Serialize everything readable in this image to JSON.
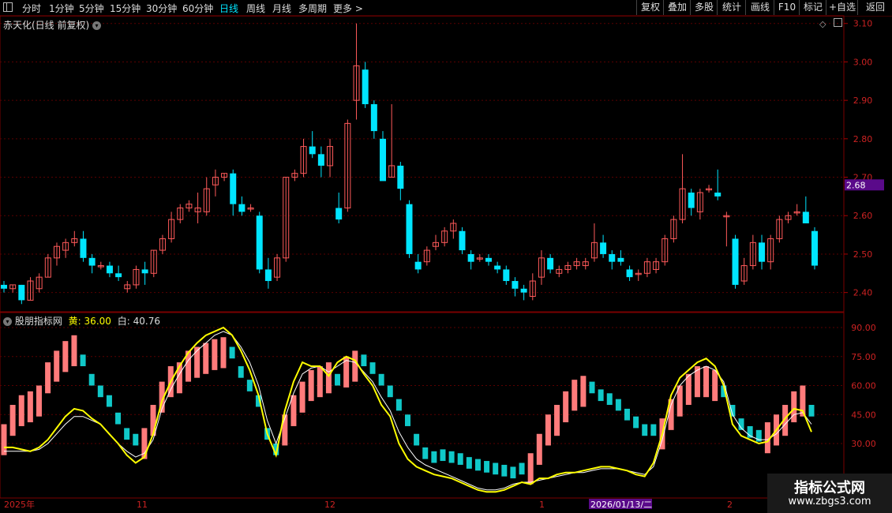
{
  "toolbar": {
    "periods": [
      "分时",
      "1分钟",
      "5分钟",
      "15分钟",
      "30分钟",
      "60分钟",
      "日线",
      "周线",
      "月线",
      "多周期",
      "更多 >"
    ],
    "active_period": "日线",
    "right_buttons": [
      "复权",
      "叠加",
      "多股",
      "统计",
      "画线",
      "F10",
      "标记",
      "+自选",
      "返回"
    ]
  },
  "main_panel": {
    "title": "赤天化(日线 前复权)",
    "price_axis": [
      "3.10",
      "3.00",
      "2.90",
      "2.80",
      "2.70",
      "2.60",
      "2.50",
      "2.40"
    ],
    "current_price": "2.68"
  },
  "indicator_panel": {
    "name": "股朋指标网",
    "yellow_label": "黄:",
    "yellow_value": "36.00",
    "white_label": "白:",
    "white_value": "40.76",
    "axis": [
      "90.00",
      "75.00",
      "60.00",
      "45.00",
      "30.00"
    ]
  },
  "time_axis": [
    "2025年",
    "11",
    "12",
    "1",
    "2026/01/13/二",
    "2"
  ],
  "watermark": {
    "title": "指标公式网",
    "url": "www.zbgs3.com"
  },
  "colors": {
    "up": "#ff5a5a",
    "down": "#00e5ff",
    "yellow": "#ffff00",
    "white": "#ffffff",
    "grid": "#5a0000"
  },
  "chart_data": {
    "type": "candlestick",
    "ohlc": [
      [
        2.42,
        2.43,
        2.4,
        2.41
      ],
      [
        2.41,
        2.42,
        2.4,
        2.42
      ],
      [
        2.42,
        2.42,
        2.37,
        2.38
      ],
      [
        2.38,
        2.44,
        2.38,
        2.43
      ],
      [
        2.41,
        2.45,
        2.4,
        2.44
      ],
      [
        2.44,
        2.5,
        2.44,
        2.49
      ],
      [
        2.49,
        2.53,
        2.47,
        2.52
      ],
      [
        2.51,
        2.54,
        2.49,
        2.53
      ],
      [
        2.53,
        2.56,
        2.52,
        2.54
      ],
      [
        2.54,
        2.56,
        2.48,
        2.49
      ],
      [
        2.49,
        2.5,
        2.45,
        2.47
      ],
      [
        2.47,
        2.48,
        2.46,
        2.47
      ],
      [
        2.47,
        2.48,
        2.44,
        2.45
      ],
      [
        2.45,
        2.47,
        2.43,
        2.44
      ],
      [
        2.41,
        2.43,
        2.4,
        2.42
      ],
      [
        2.42,
        2.47,
        2.41,
        2.46
      ],
      [
        2.46,
        2.48,
        2.42,
        2.45
      ],
      [
        2.45,
        2.51,
        2.44,
        2.51
      ],
      [
        2.51,
        2.55,
        2.5,
        2.54
      ],
      [
        2.54,
        2.61,
        2.53,
        2.59
      ],
      [
        2.59,
        2.63,
        2.58,
        2.62
      ],
      [
        2.62,
        2.64,
        2.61,
        2.63
      ],
      [
        2.61,
        2.66,
        2.58,
        2.62
      ],
      [
        2.61,
        2.7,
        2.6,
        2.67
      ],
      [
        2.68,
        2.72,
        2.65,
        2.7
      ],
      [
        2.7,
        2.71,
        2.69,
        2.71
      ],
      [
        2.71,
        2.72,
        2.6,
        2.63
      ],
      [
        2.63,
        2.65,
        2.6,
        2.61
      ],
      [
        2.62,
        2.63,
        2.61,
        2.62
      ],
      [
        2.6,
        2.61,
        2.45,
        2.46
      ],
      [
        2.46,
        2.49,
        2.41,
        2.43
      ],
      [
        2.44,
        2.5,
        2.43,
        2.49
      ],
      [
        2.49,
        2.7,
        2.48,
        2.7
      ],
      [
        2.7,
        2.72,
        2.69,
        2.71
      ],
      [
        2.71,
        2.8,
        2.7,
        2.78
      ],
      [
        2.78,
        2.82,
        2.75,
        2.76
      ],
      [
        2.76,
        2.78,
        2.7,
        2.73
      ],
      [
        2.73,
        2.8,
        2.7,
        2.78
      ],
      [
        2.62,
        2.66,
        2.58,
        2.59
      ],
      [
        2.62,
        2.85,
        2.61,
        2.84
      ],
      [
        2.9,
        3.1,
        2.85,
        2.99
      ],
      [
        2.98,
        3.0,
        2.88,
        2.89
      ],
      [
        2.89,
        2.9,
        2.8,
        2.82
      ],
      [
        2.8,
        2.82,
        2.7,
        2.69
      ],
      [
        2.7,
        2.89,
        2.7,
        2.73
      ],
      [
        2.73,
        2.74,
        2.64,
        2.67
      ],
      [
        2.63,
        2.64,
        2.49,
        2.5
      ],
      [
        2.48,
        2.5,
        2.45,
        2.46
      ],
      [
        2.48,
        2.52,
        2.47,
        2.51
      ],
      [
        2.52,
        2.55,
        2.51,
        2.53
      ],
      [
        2.53,
        2.57,
        2.52,
        2.56
      ],
      [
        2.56,
        2.59,
        2.54,
        2.58
      ],
      [
        2.56,
        2.57,
        2.5,
        2.51
      ],
      [
        2.5,
        2.51,
        2.46,
        2.48
      ],
      [
        2.49,
        2.5,
        2.48,
        2.49
      ],
      [
        2.49,
        2.5,
        2.47,
        2.48
      ],
      [
        2.47,
        2.48,
        2.45,
        2.46
      ],
      [
        2.46,
        2.47,
        2.42,
        2.43
      ],
      [
        2.43,
        2.44,
        2.39,
        2.41
      ],
      [
        2.41,
        2.42,
        2.38,
        2.4
      ],
      [
        2.39,
        2.45,
        2.38,
        2.43
      ],
      [
        2.44,
        2.51,
        2.42,
        2.49
      ],
      [
        2.49,
        2.5,
        2.45,
        2.46
      ],
      [
        2.45,
        2.47,
        2.44,
        2.46
      ],
      [
        2.46,
        2.48,
        2.45,
        2.47
      ],
      [
        2.47,
        2.49,
        2.46,
        2.48
      ],
      [
        2.47,
        2.49,
        2.46,
        2.48
      ],
      [
        2.49,
        2.58,
        2.48,
        2.53
      ],
      [
        2.53,
        2.55,
        2.49,
        2.5
      ],
      [
        2.5,
        2.51,
        2.46,
        2.48
      ],
      [
        2.49,
        2.51,
        2.47,
        2.48
      ],
      [
        2.46,
        2.47,
        2.43,
        2.44
      ],
      [
        2.45,
        2.46,
        2.43,
        2.45
      ],
      [
        2.45,
        2.49,
        2.44,
        2.48
      ],
      [
        2.46,
        2.49,
        2.45,
        2.48
      ],
      [
        2.48,
        2.55,
        2.47,
        2.54
      ],
      [
        2.54,
        2.6,
        2.53,
        2.59
      ],
      [
        2.59,
        2.76,
        2.58,
        2.67
      ],
      [
        2.66,
        2.67,
        2.6,
        2.62
      ],
      [
        2.61,
        2.67,
        2.59,
        2.66
      ],
      [
        2.67,
        2.68,
        2.66,
        2.67
      ],
      [
        2.66,
        2.72,
        2.64,
        2.65
      ],
      [
        2.6,
        2.61,
        2.52,
        2.6
      ],
      [
        2.54,
        2.55,
        2.41,
        2.42
      ],
      [
        2.43,
        2.49,
        2.42,
        2.47
      ],
      [
        2.47,
        2.55,
        2.46,
        2.53
      ],
      [
        2.53,
        2.55,
        2.46,
        2.48
      ],
      [
        2.48,
        2.55,
        2.46,
        2.54
      ],
      [
        2.54,
        2.6,
        2.53,
        2.59
      ],
      [
        2.59,
        2.61,
        2.58,
        2.6
      ],
      [
        2.61,
        2.63,
        2.6,
        2.61
      ],
      [
        2.61,
        2.65,
        2.58,
        2.58
      ],
      [
        2.56,
        2.57,
        2.46,
        2.47
      ]
    ],
    "indicator_bars": [
      [
        40,
        true
      ],
      [
        50,
        true
      ],
      [
        55,
        true
      ],
      [
        57,
        true
      ],
      [
        60,
        true
      ],
      [
        72,
        true
      ],
      [
        78,
        true
      ],
      [
        83,
        true
      ],
      [
        86,
        true
      ],
      [
        76,
        false
      ],
      [
        66,
        false
      ],
      [
        60,
        false
      ],
      [
        55,
        false
      ],
      [
        46,
        false
      ],
      [
        38,
        false
      ],
      [
        35,
        false
      ],
      [
        38,
        true
      ],
      [
        50,
        true
      ],
      [
        62,
        true
      ],
      [
        70,
        true
      ],
      [
        72,
        true
      ],
      [
        78,
        true
      ],
      [
        80,
        true
      ],
      [
        82,
        true
      ],
      [
        84,
        true
      ],
      [
        85,
        true
      ],
      [
        80,
        false
      ],
      [
        70,
        false
      ],
      [
        63,
        false
      ],
      [
        55,
        false
      ],
      [
        38,
        false
      ],
      [
        30,
        false
      ],
      [
        45,
        true
      ],
      [
        55,
        true
      ],
      [
        62,
        true
      ],
      [
        68,
        true
      ],
      [
        70,
        true
      ],
      [
        72,
        true
      ],
      [
        66,
        false
      ],
      [
        75,
        true
      ],
      [
        78,
        true
      ],
      [
        76,
        false
      ],
      [
        72,
        false
      ],
      [
        66,
        false
      ],
      [
        60,
        false
      ],
      [
        53,
        false
      ],
      [
        45,
        false
      ],
      [
        35,
        false
      ],
      [
        28,
        false
      ],
      [
        26,
        false
      ],
      [
        27,
        false
      ],
      [
        26,
        false
      ],
      [
        25,
        false
      ],
      [
        23,
        false
      ],
      [
        22,
        false
      ],
      [
        21,
        false
      ],
      [
        20,
        false
      ],
      [
        19,
        false
      ],
      [
        18,
        false
      ],
      [
        20,
        false
      ],
      [
        25,
        true
      ],
      [
        35,
        true
      ],
      [
        45,
        true
      ],
      [
        50,
        true
      ],
      [
        57,
        true
      ],
      [
        63,
        true
      ],
      [
        65,
        true
      ],
      [
        62,
        false
      ],
      [
        58,
        false
      ],
      [
        56,
        false
      ],
      [
        53,
        false
      ],
      [
        48,
        false
      ],
      [
        44,
        false
      ],
      [
        40,
        false
      ],
      [
        40,
        false
      ],
      [
        43,
        true
      ],
      [
        53,
        true
      ],
      [
        60,
        true
      ],
      [
        66,
        true
      ],
      [
        70,
        true
      ],
      [
        70,
        true
      ],
      [
        68,
        true
      ],
      [
        60,
        false
      ],
      [
        50,
        false
      ],
      [
        43,
        false
      ],
      [
        39,
        false
      ],
      [
        37,
        false
      ],
      [
        41,
        true
      ],
      [
        45,
        true
      ],
      [
        50,
        true
      ],
      [
        57,
        true
      ],
      [
        60,
        true
      ],
      [
        50,
        false
      ]
    ],
    "yellow_line": [
      28,
      28,
      27,
      26,
      28,
      32,
      38,
      44,
      48,
      47,
      43,
      40,
      35,
      30,
      24,
      20,
      23,
      35,
      52,
      62,
      70,
      77,
      82,
      86,
      88,
      90,
      86,
      78,
      68,
      55,
      35,
      24,
      47,
      62,
      72,
      70,
      70,
      65,
      72,
      75,
      73,
      66,
      60,
      50,
      44,
      30,
      22,
      18,
      16,
      14,
      13,
      12,
      10,
      8,
      6,
      5,
      5,
      6,
      8,
      10,
      9,
      12,
      12,
      14,
      15,
      15,
      16,
      17,
      18,
      18,
      17,
      16,
      14,
      13,
      20,
      35,
      55,
      64,
      68,
      72,
      74,
      70,
      60,
      40,
      34,
      32,
      30,
      31,
      37,
      43,
      48,
      47,
      36
    ],
    "white_line": [
      26,
      26,
      26,
      26,
      27,
      30,
      35,
      40,
      44,
      44,
      42,
      40,
      35,
      30,
      26,
      23,
      25,
      32,
      48,
      58,
      66,
      73,
      78,
      82,
      86,
      88,
      86,
      80,
      72,
      60,
      42,
      30,
      43,
      56,
      66,
      69,
      70,
      67,
      70,
      73,
      72,
      67,
      62,
      54,
      47,
      36,
      28,
      22,
      19,
      17,
      15,
      13,
      11,
      9,
      7,
      6,
      6,
      7,
      9,
      10,
      10,
      11,
      12,
      13,
      14,
      15,
      15,
      16,
      17,
      17,
      17,
      16,
      15,
      14,
      18,
      32,
      50,
      60,
      65,
      68,
      70,
      68,
      62,
      45,
      38,
      34,
      32,
      32,
      35,
      40,
      45,
      46,
      40
    ]
  }
}
